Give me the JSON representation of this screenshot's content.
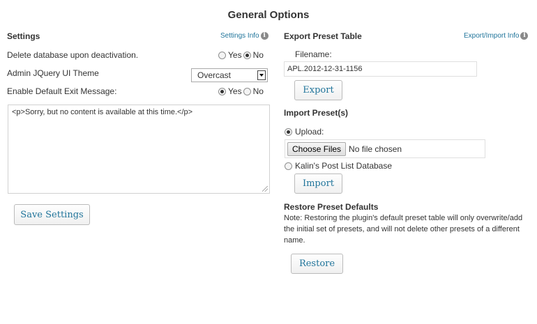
{
  "page_title": "General Options",
  "settings": {
    "heading": "Settings",
    "info_link": "Settings Info",
    "delete_db_label": "Delete database upon deactivation.",
    "delete_db_yes": "Yes",
    "delete_db_no": "No",
    "delete_db_selected": "No",
    "theme_label": "Admin JQuery UI Theme",
    "theme_value": "Overcast",
    "exit_msg_label": "Enable Default Exit Message:",
    "exit_msg_yes": "Yes",
    "exit_msg_no": "No",
    "exit_msg_selected": "Yes",
    "exit_msg_text": "<p>Sorry, but no content is available at this time.</p>",
    "save_button": "Save Settings"
  },
  "export": {
    "heading": "Export Preset Table",
    "info_link": "Export/Import Info",
    "filename_label": "Filename:",
    "filename_value": "APL.2012-12-31-1156",
    "export_button": "Export"
  },
  "import": {
    "heading": "Import Preset(s)",
    "upload_label": "Upload:",
    "choose_files_button": "Choose Files",
    "no_file_text": "No file chosen",
    "database_label": "Kalin's Post List Database",
    "selected_source": "Upload",
    "import_button": "Import"
  },
  "restore": {
    "heading": "Restore Preset Defaults",
    "note": "Note: Restoring the plugin's default preset table will only overwrite/add the initial set of presets, and will not delete other presets of a different name.",
    "restore_button": "Restore"
  },
  "colors": {
    "link_blue": "#21759b",
    "text": "#333333"
  }
}
